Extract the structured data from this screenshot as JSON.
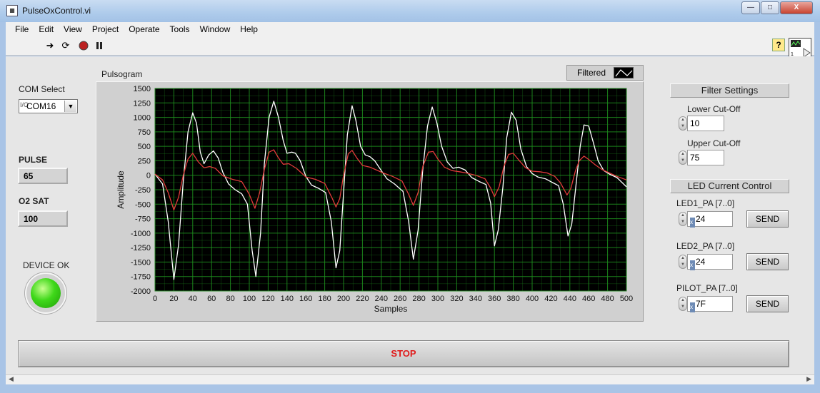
{
  "window": {
    "title": "PulseOxControl.vi",
    "buttons": {
      "minimize": "—",
      "maximize": "□",
      "close": "X"
    }
  },
  "menu": [
    "File",
    "Edit",
    "View",
    "Project",
    "Operate",
    "Tools",
    "Window",
    "Help"
  ],
  "toolbar": {
    "icons": [
      "run-arrow-icon",
      "run-continuously-icon",
      "abort-icon",
      "pause-icon"
    ],
    "help": "?"
  },
  "com": {
    "label": "COM Select",
    "prefix": "I/O",
    "value": "COM16"
  },
  "pulse": {
    "label": "PULSE",
    "value": "65"
  },
  "o2": {
    "label": "O2 SAT",
    "value": "100"
  },
  "device": {
    "label": "DEVICE OK",
    "state": "on",
    "color": "#3fd81a"
  },
  "graph": {
    "label": "Pulsogram",
    "legend_label": "Filtered"
  },
  "chart_data": {
    "type": "line",
    "title": "Pulsogram",
    "xlabel": "Samples",
    "ylabel": "Amplitude",
    "xlim": [
      0,
      500
    ],
    "ylim": [
      -2000,
      1500
    ],
    "xticks": [
      0,
      20,
      40,
      60,
      80,
      100,
      120,
      140,
      160,
      180,
      200,
      220,
      240,
      260,
      280,
      300,
      320,
      340,
      360,
      380,
      400,
      420,
      440,
      460,
      480,
      500
    ],
    "yticks": [
      1500,
      1250,
      1000,
      750,
      500,
      250,
      0,
      -250,
      -500,
      -750,
      -1000,
      -1250,
      -1500,
      -1750,
      -2000
    ],
    "grid": true,
    "background": "#000000",
    "grid_color": "#1f8f1f",
    "series": [
      {
        "color": "#ffffff",
        "points": [
          [
            0,
            20
          ],
          [
            8,
            -150
          ],
          [
            14,
            -800
          ],
          [
            20,
            -1800
          ],
          [
            25,
            -1200
          ],
          [
            30,
            -100
          ],
          [
            35,
            750
          ],
          [
            40,
            1080
          ],
          [
            44,
            900
          ],
          [
            48,
            400
          ],
          [
            52,
            200
          ],
          [
            57,
            350
          ],
          [
            62,
            420
          ],
          [
            67,
            300
          ],
          [
            72,
            50
          ],
          [
            78,
            -150
          ],
          [
            85,
            -250
          ],
          [
            92,
            -320
          ],
          [
            98,
            -500
          ],
          [
            103,
            -1300
          ],
          [
            107,
            -1750
          ],
          [
            112,
            -1000
          ],
          [
            116,
            200
          ],
          [
            121,
            1000
          ],
          [
            126,
            1280
          ],
          [
            131,
            1000
          ],
          [
            136,
            600
          ],
          [
            140,
            380
          ],
          [
            145,
            400
          ],
          [
            149,
            380
          ],
          [
            154,
            250
          ],
          [
            160,
            -20
          ],
          [
            166,
            -170
          ],
          [
            174,
            -230
          ],
          [
            181,
            -300
          ],
          [
            187,
            -800
          ],
          [
            192,
            -1600
          ],
          [
            196,
            -1300
          ],
          [
            200,
            -300
          ],
          [
            204,
            700
          ],
          [
            209,
            1200
          ],
          [
            213,
            950
          ],
          [
            218,
            500
          ],
          [
            223,
            350
          ],
          [
            228,
            320
          ],
          [
            233,
            250
          ],
          [
            240,
            80
          ],
          [
            246,
            -60
          ],
          [
            254,
            -150
          ],
          [
            263,
            -280
          ],
          [
            269,
            -800
          ],
          [
            274,
            -1450
          ],
          [
            279,
            -950
          ],
          [
            284,
            100
          ],
          [
            289,
            850
          ],
          [
            294,
            1180
          ],
          [
            299,
            900
          ],
          [
            304,
            500
          ],
          [
            310,
            230
          ],
          [
            316,
            120
          ],
          [
            322,
            140
          ],
          [
            329,
            90
          ],
          [
            336,
            -40
          ],
          [
            344,
            -110
          ],
          [
            351,
            -160
          ],
          [
            356,
            -480
          ],
          [
            360,
            -1220
          ],
          [
            364,
            -950
          ],
          [
            369,
            -200
          ],
          [
            373,
            650
          ],
          [
            378,
            1090
          ],
          [
            383,
            950
          ],
          [
            388,
            450
          ],
          [
            394,
            150
          ],
          [
            400,
            30
          ],
          [
            406,
            -30
          ],
          [
            414,
            -60
          ],
          [
            421,
            -120
          ],
          [
            428,
            -180
          ],
          [
            433,
            -500
          ],
          [
            438,
            -1050
          ],
          [
            442,
            -850
          ],
          [
            447,
            -100
          ],
          [
            451,
            500
          ],
          [
            455,
            870
          ],
          [
            460,
            850
          ],
          [
            465,
            560
          ],
          [
            470,
            250
          ],
          [
            476,
            80
          ],
          [
            482,
            20
          ],
          [
            490,
            -40
          ],
          [
            500,
            -200
          ]
        ]
      },
      {
        "color": "#e03a3a",
        "points": [
          [
            0,
            20
          ],
          [
            8,
            -80
          ],
          [
            14,
            -300
          ],
          [
            20,
            -600
          ],
          [
            25,
            -380
          ],
          [
            30,
            0
          ],
          [
            35,
            280
          ],
          [
            40,
            380
          ],
          [
            46,
            230
          ],
          [
            52,
            130
          ],
          [
            58,
            150
          ],
          [
            64,
            120
          ],
          [
            72,
            -10
          ],
          [
            82,
            -70
          ],
          [
            92,
            -110
          ],
          [
            100,
            -330
          ],
          [
            106,
            -570
          ],
          [
            111,
            -300
          ],
          [
            116,
            100
          ],
          [
            121,
            400
          ],
          [
            126,
            440
          ],
          [
            131,
            300
          ],
          [
            136,
            190
          ],
          [
            142,
            200
          ],
          [
            150,
            120
          ],
          [
            160,
            -30
          ],
          [
            170,
            -70
          ],
          [
            180,
            -140
          ],
          [
            188,
            -400
          ],
          [
            192,
            -550
          ],
          [
            196,
            -400
          ],
          [
            200,
            0
          ],
          [
            205,
            370
          ],
          [
            209,
            430
          ],
          [
            214,
            300
          ],
          [
            220,
            170
          ],
          [
            228,
            140
          ],
          [
            235,
            90
          ],
          [
            242,
            40
          ],
          [
            252,
            -20
          ],
          [
            262,
            -100
          ],
          [
            269,
            -330
          ],
          [
            274,
            -520
          ],
          [
            279,
            -300
          ],
          [
            284,
            150
          ],
          [
            290,
            400
          ],
          [
            295,
            410
          ],
          [
            300,
            280
          ],
          [
            307,
            140
          ],
          [
            315,
            80
          ],
          [
            323,
            60
          ],
          [
            330,
            40
          ],
          [
            340,
            0
          ],
          [
            350,
            -60
          ],
          [
            356,
            -220
          ],
          [
            360,
            -370
          ],
          [
            365,
            -200
          ],
          [
            370,
            150
          ],
          [
            375,
            360
          ],
          [
            380,
            380
          ],
          [
            386,
            260
          ],
          [
            393,
            130
          ],
          [
            400,
            70
          ],
          [
            408,
            60
          ],
          [
            416,
            40
          ],
          [
            424,
            -20
          ],
          [
            430,
            -130
          ],
          [
            437,
            -340
          ],
          [
            441,
            -230
          ],
          [
            446,
            80
          ],
          [
            450,
            250
          ],
          [
            455,
            330
          ],
          [
            461,
            260
          ],
          [
            467,
            180
          ],
          [
            474,
            100
          ],
          [
            482,
            40
          ],
          [
            490,
            -20
          ],
          [
            500,
            -80
          ]
        ]
      }
    ]
  },
  "filter": {
    "header": "Filter Settings",
    "lower_label": "Lower Cut-Off",
    "lower_value": "10",
    "upper_label": "Upper Cut-Off",
    "upper_value": "75"
  },
  "led": {
    "header": "LED Current Control",
    "rows": [
      {
        "label": "LED1_PA [7..0]",
        "radix": "x",
        "value": "24",
        "button": "SEND"
      },
      {
        "label": "LED2_PA [7..0]",
        "radix": "x",
        "value": "24",
        "button": "SEND"
      },
      {
        "label": "PILOT_PA [7..0]",
        "radix": "x",
        "value": "7F",
        "button": "SEND"
      }
    ]
  },
  "stop": {
    "label": "STOP",
    "color": "#e01b1b"
  }
}
